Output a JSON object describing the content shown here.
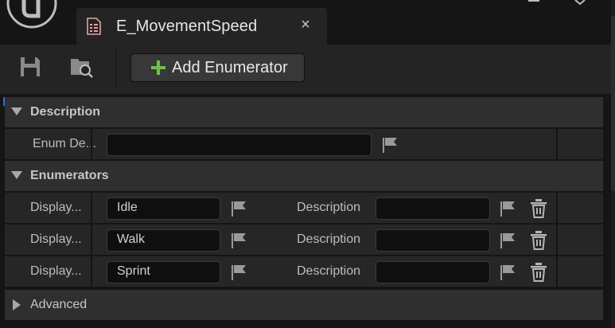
{
  "tab": {
    "title": "E_MovementSpeed",
    "close_glyph": "×",
    "icon": "enum-asset-icon"
  },
  "toolbar": {
    "save_icon": "save-icon",
    "browse_icon": "browse-icon",
    "add_label": "Add Enumerator"
  },
  "description_section": {
    "title": "Description",
    "row": {
      "name": "Enum De...",
      "value": ""
    }
  },
  "enumerators_section": {
    "title": "Enumerators",
    "rows": [
      {
        "name": "Display...",
        "value": "Idle",
        "desc_label": "Description",
        "desc_value": ""
      },
      {
        "name": "Display...",
        "value": "Walk",
        "desc_label": "Description",
        "desc_value": ""
      },
      {
        "name": "Display...",
        "value": "Sprint",
        "desc_label": "Description",
        "desc_value": ""
      }
    ]
  },
  "advanced_section": {
    "title": "Advanced"
  },
  "colors": {
    "accent_green": "#6cc24a",
    "accent_blue": "#2a6de0",
    "tab_icon": "#e8a0a0"
  }
}
